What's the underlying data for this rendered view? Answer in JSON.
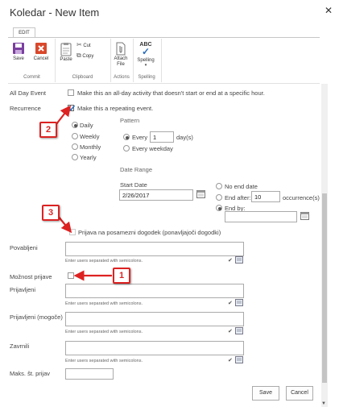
{
  "dialog": {
    "title": "Koledar - New Item",
    "close_icon": "close-icon"
  },
  "ribbon": {
    "tab": "EDIT",
    "buttons": {
      "save": "Save",
      "cancel": "Cancel",
      "paste": "Paste",
      "cut": "Cut",
      "copy": "Copy",
      "attach": "Attach File",
      "spelling": "Spelling",
      "spelling_icon_text": "ABC"
    },
    "groups": {
      "commit": "Commit",
      "clipboard": "Clipboard",
      "actions": "Actions",
      "spelling": "Spelling"
    }
  },
  "form": {
    "all_day_label": "All Day Event",
    "all_day_text": "Make this an all-day activity that doesn't start or end at a specific hour.",
    "recurrence_label": "Recurrence",
    "recurrence_text": "Make this a repeating event.",
    "recurrence_checked": true,
    "frequency": [
      "Daily",
      "Weekly",
      "Monthly",
      "Yearly"
    ],
    "frequency_selected": "Daily",
    "pattern_title": "Pattern",
    "pattern_every": "Every",
    "pattern_every_value": "1",
    "pattern_days": "day(s)",
    "pattern_weekday": "Every weekday",
    "date_range_title": "Date Range",
    "start_date_label": "Start Date",
    "start_date_value": "2/26/2017",
    "no_end": "No end date",
    "end_after": "End after:",
    "end_after_value": "10",
    "occurrences": "occurrence(s)",
    "end_by": "End by:",
    "prijava_text": "Prijava na posamezni dogodek (ponavljajoči dogodki)",
    "povabljeni_label": "Povabljeni",
    "people_hint": "Enter users separated with semicolons.",
    "moznost_label": "Možnost prijave",
    "prijavljeni_label": "Prijavljeni",
    "prijavljeni_mogoce_label": "Prijavljeni (mogoče)",
    "zavrnili_label": "Zavrnili",
    "maks_label": "Maks. št. prijav"
  },
  "buttons": {
    "save": "Save",
    "cancel": "Cancel"
  },
  "callouts": {
    "one": "1",
    "two": "2",
    "three": "3"
  },
  "colors": {
    "accent": "#2a6ebb",
    "callout": "#dd2222",
    "save_icon": "#7b3fa0",
    "cancel_icon": "#d9482b"
  }
}
